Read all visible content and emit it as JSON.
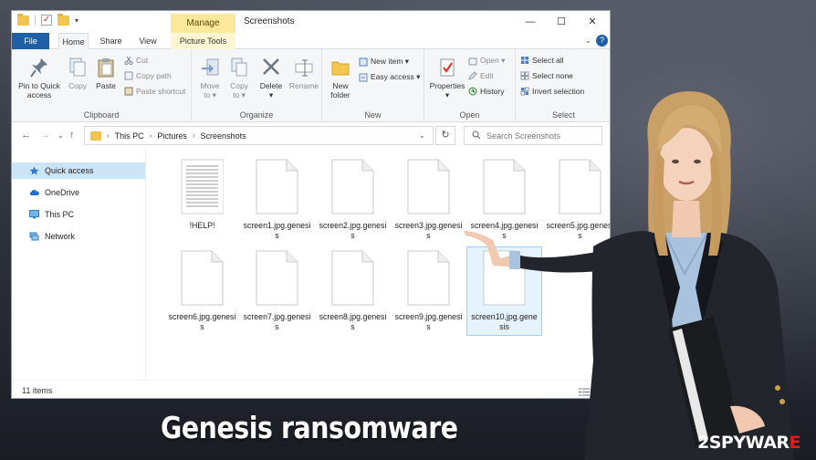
{
  "window": {
    "title": "Screenshots",
    "manage_tab": "Manage",
    "controls": {
      "minimize": "—",
      "maximize": "☐",
      "close": "✕"
    }
  },
  "tabs": [
    "File",
    "Home",
    "Share",
    "View",
    "Picture Tools"
  ],
  "ribbon": {
    "clipboard": {
      "label": "Clipboard",
      "pin_line1": "Pin to Quick",
      "pin_line2": "access",
      "copy": "Copy",
      "paste": "Paste",
      "cut": "Cut",
      "copy_path": "Copy path",
      "paste_shortcut": "Paste shortcut"
    },
    "organize": {
      "label": "Organize",
      "move_to_line1": "Move",
      "move_to_line2": "to ▾",
      "copy_to_line1": "Copy",
      "copy_to_line2": "to ▾",
      "delete_line1": "Delete",
      "delete_line2": "▾",
      "rename": "Rename"
    },
    "new": {
      "label": "New",
      "new_folder_line1": "New",
      "new_folder_line2": "folder",
      "new_item": "New item ▾",
      "easy_access": "Easy access ▾"
    },
    "open": {
      "label": "Open",
      "properties_line1": "Properties",
      "properties_line2": "▾",
      "open": "Open ▾",
      "edit": "Edit",
      "history": "History"
    },
    "select": {
      "label": "Select",
      "select_all": "Select all",
      "select_none": "Select none",
      "invert": "Invert selection"
    }
  },
  "address": {
    "path": [
      "This PC",
      "Pictures",
      "Screenshots"
    ],
    "search_placeholder": "Search Screenshots"
  },
  "nav_pane": [
    {
      "label": "Quick access",
      "icon": "star-icon"
    },
    {
      "label": "OneDrive",
      "icon": "cloud-icon"
    },
    {
      "label": "This PC",
      "icon": "monitor-icon"
    },
    {
      "label": "Network",
      "icon": "network-icon"
    }
  ],
  "files": [
    {
      "name": "!HELP!",
      "type": "text"
    },
    {
      "name": "screen1.jpg.genesis",
      "type": "blank"
    },
    {
      "name": "screen2.jpg.genesis",
      "type": "blank"
    },
    {
      "name": "screen3.jpg.genesis",
      "type": "blank"
    },
    {
      "name": "screen4.jpg.genesis",
      "type": "blank"
    },
    {
      "name": "screen5.jpg.genesis",
      "type": "blank"
    },
    {
      "name": "screen6.jpg.genesis",
      "type": "blank"
    },
    {
      "name": "screen7.jpg.genesis",
      "type": "blank"
    },
    {
      "name": "screen8.jpg.genesis",
      "type": "blank"
    },
    {
      "name": "screen9.jpg.genesis",
      "type": "blank"
    },
    {
      "name": "screen10.jpg.genesis",
      "type": "blank"
    }
  ],
  "status": {
    "count": "11 items"
  },
  "caption": "Genesis ransomware",
  "logo": {
    "prefix": "2",
    "mid": "SPYWAR",
    "r": "E"
  }
}
